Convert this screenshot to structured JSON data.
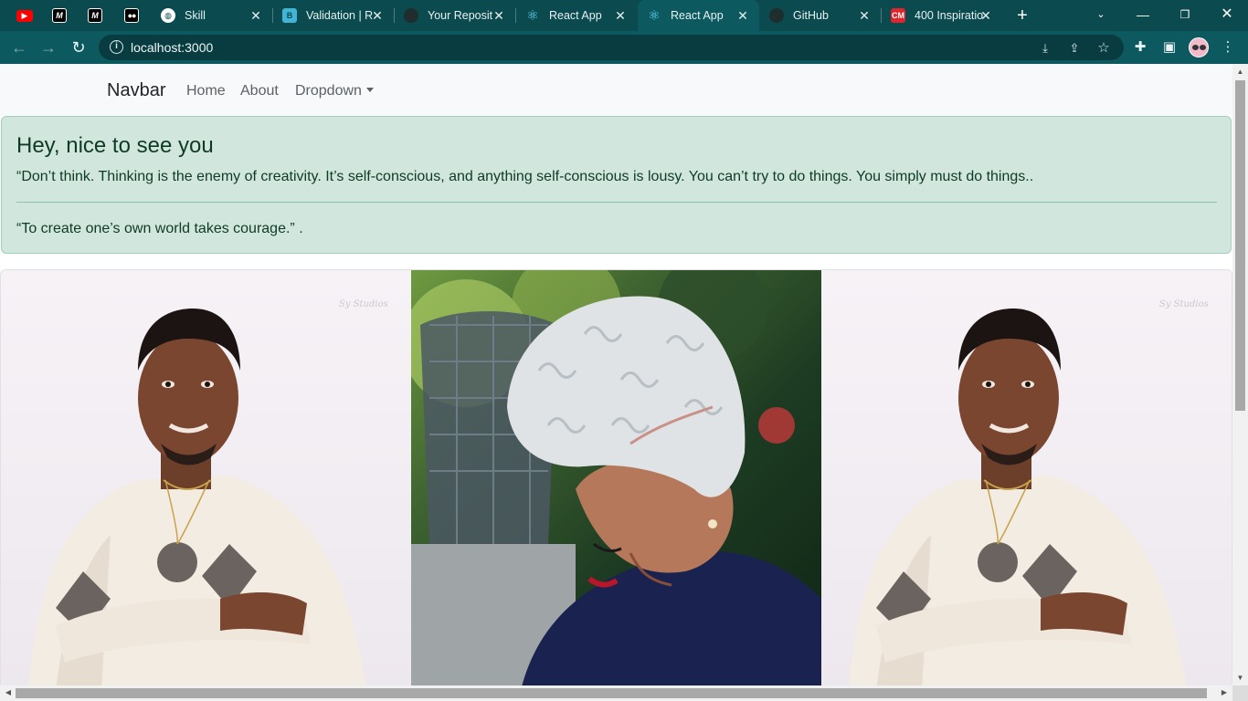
{
  "browser": {
    "tabs": [
      {
        "title": "",
        "icon": "youtube-icon",
        "color": "#ff0000"
      },
      {
        "title": "",
        "icon": "medium-m-icon",
        "color": "#000000"
      },
      {
        "title": "",
        "icon": "medium-m-icon",
        "color": "#000000"
      },
      {
        "title": "",
        "icon": "medium-dots-icon",
        "color": "#000000"
      },
      {
        "title": "Skill",
        "icon": "globe-icon",
        "color": "#ffffff"
      },
      {
        "title": "Validation | R",
        "icon": "react-bootstrap-icon",
        "color": "#41b4d7"
      },
      {
        "title": "Your Reposit",
        "icon": "github-icon",
        "color": "#1f2d2d"
      },
      {
        "title": "React App",
        "icon": "react-icon",
        "color": "#61dafb"
      },
      {
        "title": "React App",
        "icon": "react-icon",
        "color": "#61dafb",
        "active": true
      },
      {
        "title": "GitHub",
        "icon": "github-icon",
        "color": "#1f2d2d"
      },
      {
        "title": "400 Inspiratio",
        "icon": "cm-icon",
        "color": "#e0242b",
        "badge": "CM"
      }
    ],
    "address": "localhost:3000",
    "colors": {
      "tabstrip": "#0b4a4f",
      "toolbar": "#0c5a60"
    }
  },
  "navbar": {
    "brand": "Navbar",
    "links": [
      "Home",
      "About"
    ],
    "dropdown": "Dropdown"
  },
  "alert": {
    "heading": "Hey, nice to see you",
    "paragraph1": "“Don’t think. Thinking is the enemy of creativity. It’s self-conscious, and anything self-conscious is lousy. You can’t try to do things. You simply must do things..",
    "paragraph2": "“To create one’s own world takes courage.” .",
    "color": "#d1e7dd"
  },
  "gallery": {
    "photos": [
      {
        "subject": "man in cream sweater with arms crossed",
        "watermark": "Sy Studios"
      },
      {
        "subject": "woman with short silver curly hair looking down",
        "watermark": ""
      },
      {
        "subject": "man in cream sweater with arms crossed",
        "watermark": "Sy Studios"
      }
    ]
  }
}
